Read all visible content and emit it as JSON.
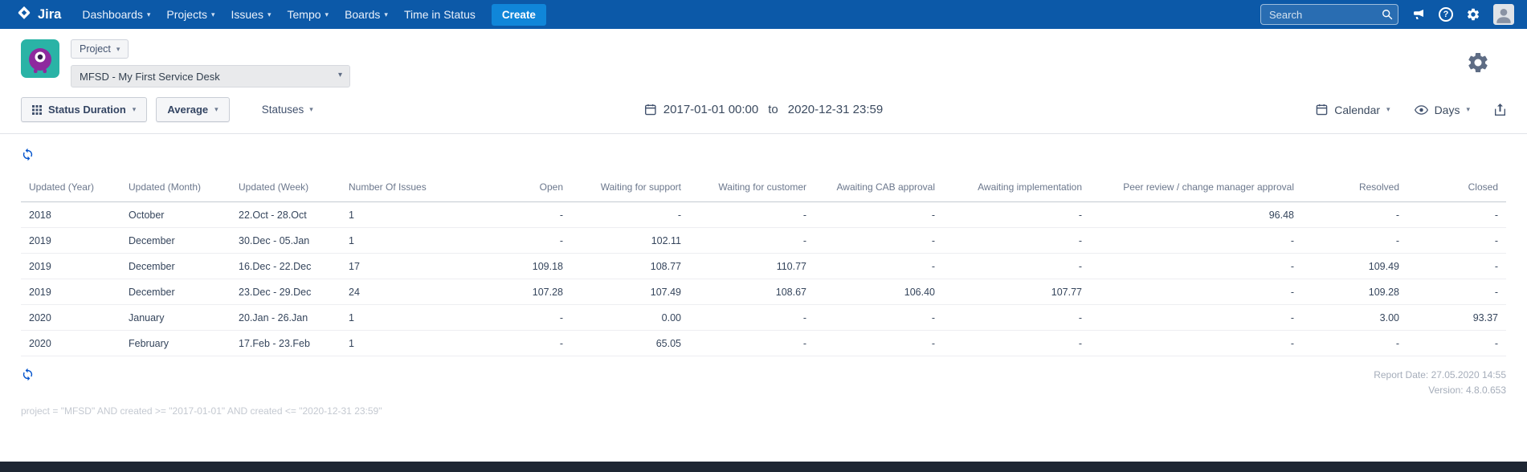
{
  "nav": {
    "brand": "Jira",
    "items": [
      {
        "label": "Dashboards"
      },
      {
        "label": "Projects"
      },
      {
        "label": "Issues"
      },
      {
        "label": "Tempo"
      },
      {
        "label": "Boards"
      },
      {
        "label": "Time in Status"
      }
    ],
    "create_label": "Create",
    "search_placeholder": "Search"
  },
  "project_header": {
    "scope_label": "Project",
    "selected_project": "MFSD - My First Service Desk"
  },
  "toolbar": {
    "report_type_label": "Status Duration",
    "aggregation_label": "Average",
    "statuses_label": "Statuses",
    "date_from": "2017-01-01 00:00",
    "date_separator": "to",
    "date_to": "2020-12-31 23:59",
    "calendar_label": "Calendar",
    "unit_label": "Days"
  },
  "table": {
    "columns": [
      "Updated (Year)",
      "Updated (Month)",
      "Updated (Week)",
      "Number Of Issues",
      "Open",
      "Waiting for support",
      "Waiting for customer",
      "Awaiting CAB approval",
      "Awaiting implementation",
      "Peer review / change manager approval",
      "Resolved",
      "Closed"
    ],
    "rows": [
      [
        "2018",
        "October",
        "22.Oct - 28.Oct",
        "1",
        "-",
        "-",
        "-",
        "-",
        "-",
        "96.48",
        "-",
        "-"
      ],
      [
        "2019",
        "December",
        "30.Dec - 05.Jan",
        "1",
        "-",
        "102.11",
        "-",
        "-",
        "-",
        "-",
        "-",
        "-"
      ],
      [
        "2019",
        "December",
        "16.Dec - 22.Dec",
        "17",
        "109.18",
        "108.77",
        "110.77",
        "-",
        "-",
        "-",
        "109.49",
        "-"
      ],
      [
        "2019",
        "December",
        "23.Dec - 29.Dec",
        "24",
        "107.28",
        "107.49",
        "108.67",
        "106.40",
        "107.77",
        "-",
        "109.28",
        "-"
      ],
      [
        "2020",
        "January",
        "20.Jan - 26.Jan",
        "1",
        "-",
        "0.00",
        "-",
        "-",
        "-",
        "-",
        "3.00",
        "93.37"
      ],
      [
        "2020",
        "February",
        "17.Feb - 23.Feb",
        "1",
        "-",
        "65.05",
        "-",
        "-",
        "-",
        "-",
        "-",
        "-"
      ]
    ]
  },
  "footer": {
    "report_date": "Report Date: 27.05.2020 14:55",
    "version": "Version: 4.8.0.653",
    "jql": "project = \"MFSD\" AND created >= \"2017-01-01\" AND created <= \"2020-12-31 23:59\""
  },
  "icons": {
    "chevron_down": "▾",
    "help": "?"
  },
  "colors": {
    "nav_background": "#0c59a8",
    "create_button": "#1086d9",
    "accent_blue": "#0052cc",
    "project_avatar_teal": "#2ab3a6",
    "project_avatar_purple": "#8e2a9e"
  }
}
